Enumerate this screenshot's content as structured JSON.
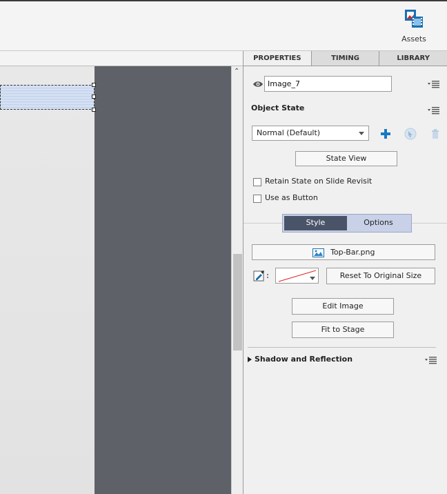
{
  "toolbar": {
    "assets_label": "Assets"
  },
  "tabs": [
    {
      "label": "PROPERTIES",
      "active": true
    },
    {
      "label": "TIMING",
      "active": false
    },
    {
      "label": "LIBRARY",
      "active": false
    }
  ],
  "properties": {
    "object_name": "Image_7",
    "object_state_title": "Object State",
    "state_select_value": "Normal (Default)",
    "state_view_label": "State View",
    "retain_state_label": "Retain State on Slide Revisit",
    "retain_state_checked": false,
    "use_as_button_label": "Use as Button",
    "use_as_button_checked": false,
    "style_tab_label": "Style",
    "options_tab_label": "Options",
    "image_file": "Top-Bar.png",
    "reset_size_label": "Reset To Original Size",
    "edit_image_label": "Edit Image",
    "fit_to_stage_label": "Fit to Stage",
    "shadow_reflection_label": "Shadow and Reflection"
  },
  "colors": {
    "add_state_blue": "#1a78c2",
    "segment_active": "#4a5468",
    "stage_gray": "#5f6168"
  }
}
